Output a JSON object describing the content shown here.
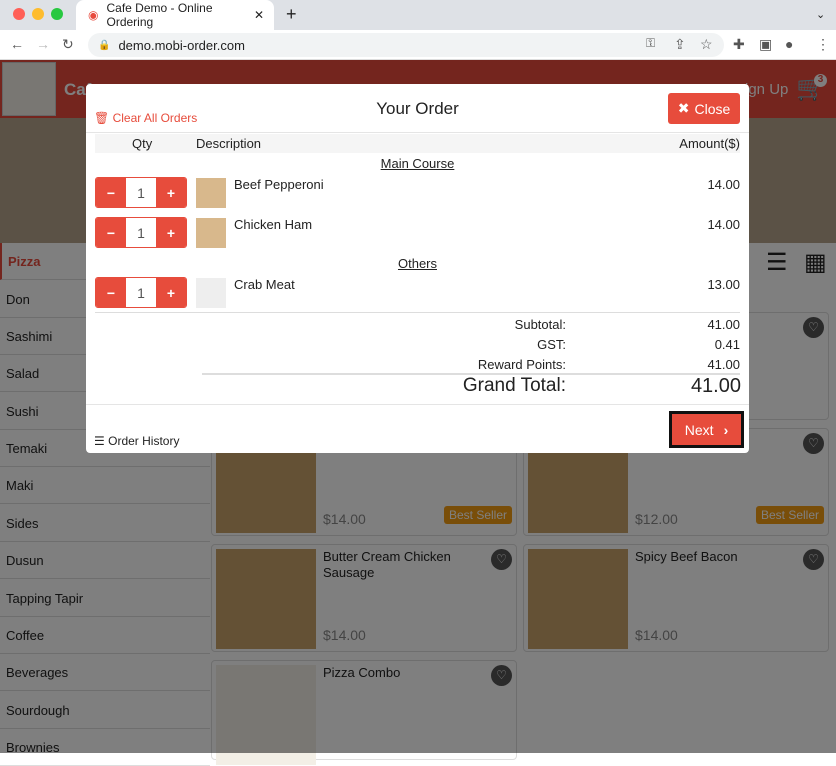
{
  "browser": {
    "tab_title": "Cafe Demo - Online Ordering",
    "url": "demo.mobi-order.com"
  },
  "site": {
    "brand": "Cafe",
    "signup": "Sign Up",
    "cart_count": "3",
    "categories": [
      "Pizza",
      "Don",
      "Sashimi",
      "Salad",
      "Sushi",
      "Temaki",
      "Maki",
      "Sides",
      "Dusun",
      "Tapping Tapir",
      "Coffee",
      "Beverages",
      "Sourdough",
      "Brownies"
    ],
    "products": [
      {
        "name": "",
        "price": "$14.00",
        "badge": "Best Seller"
      },
      {
        "name": "",
        "price": "$12.00",
        "badge": "Best Seller"
      },
      {
        "name": "Butter Cream Chicken Sausage",
        "price": "$14.00"
      },
      {
        "name": "Spicy Beef Bacon",
        "price": "$14.00"
      },
      {
        "name": "Pizza Combo",
        "price": ""
      }
    ]
  },
  "modal": {
    "title": "Your Order",
    "clear": "Clear All Orders",
    "close": "Close",
    "headers": {
      "qty": "Qty",
      "desc": "Description",
      "amount": "Amount($)"
    },
    "groups": [
      {
        "name": "Main Course",
        "items": [
          {
            "qty": "1",
            "name": "Beef Pepperoni",
            "amount": "14.00"
          },
          {
            "qty": "1",
            "name": "Chicken Ham",
            "amount": "14.00"
          }
        ]
      },
      {
        "name": "Others",
        "items": [
          {
            "qty": "1",
            "name": "Crab Meat",
            "amount": "13.00"
          }
        ]
      }
    ],
    "subtotal_label": "Subtotal:",
    "subtotal": "41.00",
    "gst_label": "GST:",
    "gst": "0.41",
    "reward_label": "Reward Points:",
    "reward": "41.00",
    "grand_label": "Grand Total:",
    "grand": "41.00",
    "history": "Order History",
    "next": "Next"
  }
}
